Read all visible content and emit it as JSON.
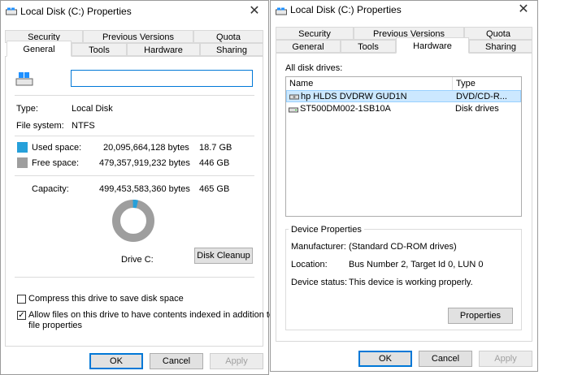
{
  "left": {
    "title": "Local Disk (C:) Properties",
    "close": "✕",
    "tabs_row1": [
      "Security",
      "Previous Versions",
      "Quota"
    ],
    "tabs_row2": [
      "General",
      "Tools",
      "Hardware",
      "Sharing"
    ],
    "active_tab": "General",
    "name_input_value": "",
    "type_label": "Type:",
    "type_value": "Local Disk",
    "fs_label": "File system:",
    "fs_value": "NTFS",
    "used_label": "Used space:",
    "used_bytes": "20,095,664,128 bytes",
    "used_size": "18.7 GB",
    "free_label": "Free space:",
    "free_bytes": "479,357,919,232 bytes",
    "free_size": "446 GB",
    "capacity_label": "Capacity:",
    "capacity_bytes": "499,453,583,360 bytes",
    "capacity_size": "465 GB",
    "used_fraction": 0.0402,
    "drive_label": "Drive C:",
    "disk_cleanup": "Disk Cleanup",
    "compress_label": "Compress this drive to save disk space",
    "compress_checked": false,
    "index_label_line1": "Allow files on this drive to have contents indexed in addition to",
    "index_label_line2": "file properties",
    "index_checked": true,
    "ok": "OK",
    "cancel": "Cancel",
    "apply": "Apply",
    "colors": {
      "used": "#26a0da",
      "free": "#9e9e9e",
      "accent": "#0078d7"
    }
  },
  "right": {
    "title": "Local Disk (C:) Properties",
    "close": "✕",
    "tabs_row1": [
      "Security",
      "Previous Versions",
      "Quota"
    ],
    "tabs_row2": [
      "General",
      "Tools",
      "Hardware",
      "Sharing"
    ],
    "active_tab": "Hardware",
    "all_disk_drives": "All disk drives:",
    "col_name": "Name",
    "col_type": "Type",
    "drives": [
      {
        "name": "hp HLDS DVDRW  GUD1N",
        "type": "DVD/CD-R...",
        "icon": "dvd-drive-icon",
        "selected": true
      },
      {
        "name": "ST500DM002-1SB10A",
        "type": "Disk drives",
        "icon": "disk-drive-icon",
        "selected": false
      }
    ],
    "device_properties": "Device Properties",
    "manufacturer_label": "Manufacturer:",
    "manufacturer_value": "(Standard CD-ROM drives)",
    "location_label": "Location:",
    "location_value": "Bus Number 2, Target Id 0, LUN 0",
    "status_label": "Device status:",
    "status_value": "This device is working properly.",
    "properties_button": "Properties",
    "ok": "OK",
    "cancel": "Cancel",
    "apply": "Apply"
  }
}
